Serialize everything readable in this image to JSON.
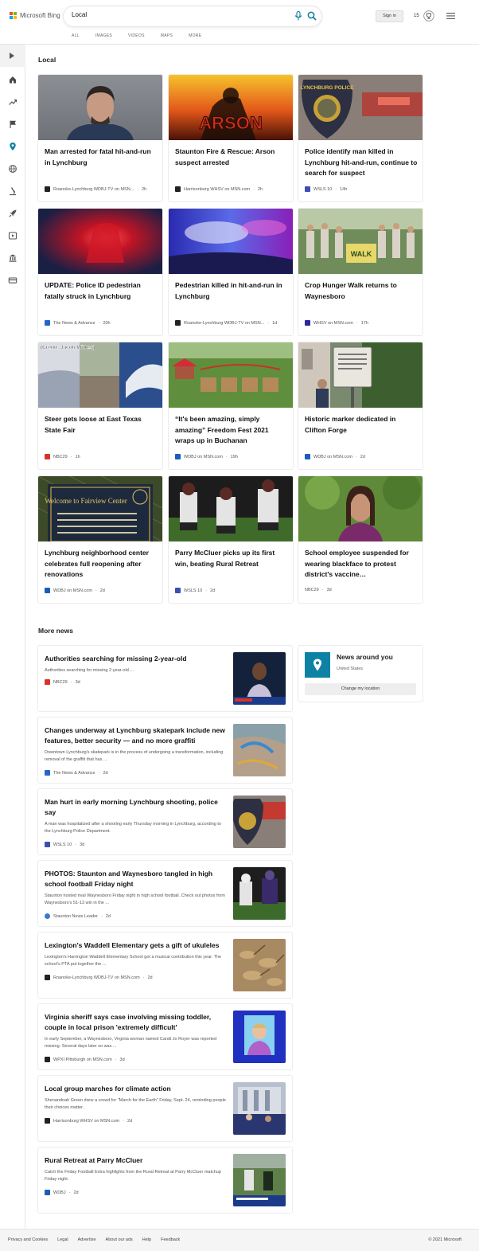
{
  "header": {
    "brand": "Microsoft Bing",
    "search_value": "Local",
    "tabs": [
      "ALL",
      "IMAGES",
      "VIDEOS",
      "MAPS",
      "MORE"
    ],
    "signin": "Sign in",
    "points": "15"
  },
  "local": {
    "title": "Local",
    "cards": [
      {
        "title": "Man arrested for fatal hit-and-run in Lynchburg",
        "source": "Roanoke-Lynchburg WDBJ-TV on MSN...",
        "age": "2h"
      },
      {
        "title": "Staunton Fire & Rescue: Arson suspect arrested",
        "source": "Harrisonburg WHSV on MSN.com",
        "age": "2h"
      },
      {
        "title": "Police identify man killed in Lynchburg hit-and-run, continue to search for suspect",
        "source": "WSLS 10",
        "age": "14h"
      },
      {
        "title": "UPDATE: Police ID pedestrian fatally struck in Lynchburg",
        "source": "The News & Advance",
        "age": "20h"
      },
      {
        "title": "Pedestrian killed in hit-and-run in Lynchburg",
        "source": "Roanoke-Lynchburg WDBJ-TV on MSN...",
        "age": "1d"
      },
      {
        "title": "Crop Hunger Walk returns to Waynesboro",
        "source": "WHSV on MSN.com",
        "age": "17h"
      },
      {
        "title": "Steer gets loose at East Texas State Fair",
        "source": "NBC29",
        "age": "1h"
      },
      {
        "title": "“It's been amazing, simply amazing” Freedom Fest 2021 wraps up in Buchanan",
        "source": "WDBJ on MSN.com",
        "age": "19h"
      },
      {
        "title": "Historic marker dedicated in Clifton Forge",
        "source": "WDBJ on MSN.com",
        "age": "2d"
      },
      {
        "title": "Lynchburg neighborhood center celebrates full reopening after renovations",
        "source": "WDBJ on MSN.com",
        "age": "2d"
      },
      {
        "title": "Parry McCluer picks up its first win, beating Rural Retreat",
        "source": "WSLS 10",
        "age": "2d"
      },
      {
        "title": "School employee suspended for wearing blackface to protest district's vaccine…",
        "source": "NBC29",
        "age": "3d"
      }
    ],
    "img_texts": {
      "arson": "ARSON",
      "police": "LYNCHBURG POLICE",
      "credit": "(Credit: Jacob Wilkes)",
      "walk": "WALK",
      "fairview": "Welcome to Fairview Center",
      "dot": "·"
    }
  },
  "more": {
    "title": "More news",
    "items": [
      {
        "title": "Authorities searching for missing 2-year-old",
        "snippet": "Authorities searching for missing 2-year-old ...",
        "source": "NBC29",
        "age": "3d"
      },
      {
        "title": "Changes underway at Lynchburg skatepark include new features, better security — and no more graffiti",
        "snippet": "Downtown Lynchburg's skatepark is in the process of undergoing a transformation, including removal of the graffiti that has ...",
        "source": "The News & Advance",
        "age": "2d"
      },
      {
        "title": "Man hurt in early morning Lynchburg shooting, police say",
        "snippet": "A man was hospitalized after a shooting early Thursday morning in Lynchburg, according to the Lynchburg Police Department.",
        "source": "WSLS 10",
        "age": "3d"
      },
      {
        "title": "PHOTOS: Staunton and Waynesboro tangled in high school football Friday night",
        "snippet": "Staunton hosted rival Waynesboro Friday night in high school football. Check out photos from Waynesboro's 51-13 win in the ...",
        "source": "Staunton News Leader",
        "age": "2d"
      },
      {
        "title": "Lexington's Waddell Elementary gets a gift of ukuleles",
        "snippet": "Lexington's Harrington Waddell Elementary School got a musical contribution this year. The school's PTA put together the ...",
        "source": "Roanoke-Lynchburg WDBJ-TV on MSN.com",
        "age": "2d"
      },
      {
        "title": "Virginia sheriff says case involving missing toddler, couple in local prison 'extremely difficult'",
        "snippet": "In early September, a Waynesboro, Virginia woman named Candi Jo Royer was reported missing. Several days later so was ...",
        "source": "WPXI Pittsburgh on MSN.com",
        "age": "3d"
      },
      {
        "title": "Local group marches for climate action",
        "snippet": "Shenandoah Green drew a crowd for \"March for the Earth\" Friday, Sept. 24, reminding people their choices matter.",
        "source": "Harrisonburg WHSV on MSN.com",
        "age": "2d"
      },
      {
        "title": "Rural Retreat at Parry McCluer",
        "snippet": "Catch the Friday Football Extra highlights from the Rural Retreat at Parry McCluer matchup Friday night.",
        "source": "WDBJ",
        "age": "2d"
      }
    ]
  },
  "around": {
    "title": "News around you",
    "location": "United States",
    "button": "Change my location"
  },
  "footer": {
    "links": [
      "Privacy and Cookies",
      "Legal",
      "Advertise",
      "About our ads",
      "Help",
      "Feedback"
    ],
    "copyright": "© 2021 Microsoft"
  }
}
